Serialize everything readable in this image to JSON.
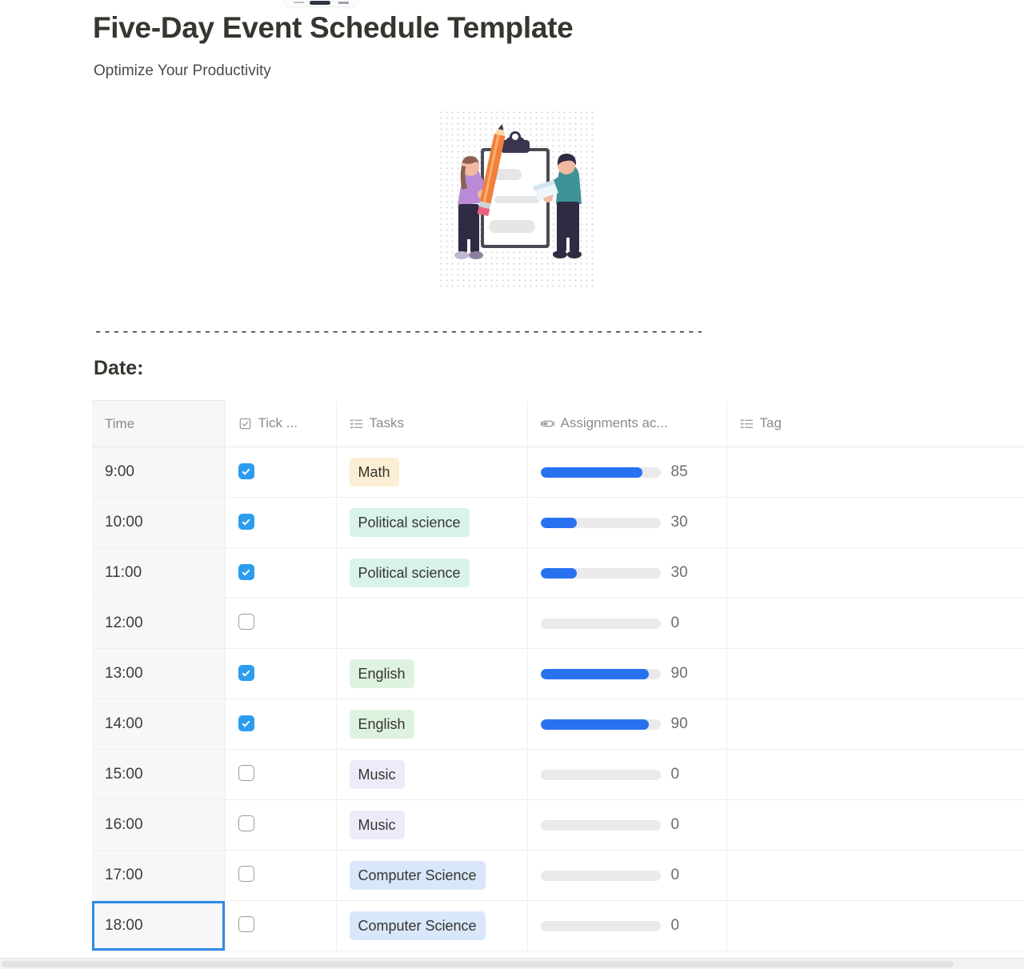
{
  "document": {
    "title": "Five-Day Event Schedule Template",
    "subtitle": "Optimize Your Productivity",
    "divider": "----------------------------------------------------------------------------",
    "date_label": "Date:"
  },
  "illustration": {
    "name": "clipboard-checklist-illustration",
    "alt": "Two people with a giant clipboard and pencil"
  },
  "table": {
    "columns": [
      {
        "key": "time",
        "label": "Time",
        "icon": ""
      },
      {
        "key": "tick",
        "label": "Tick ...",
        "icon": "checkbox-icon"
      },
      {
        "key": "tasks",
        "label": "Tasks",
        "icon": "select-list-icon"
      },
      {
        "key": "assignments",
        "label": "Assignments ac...",
        "icon": "progress-icon"
      },
      {
        "key": "tag",
        "label": "Tag",
        "icon": "select-list-icon"
      }
    ],
    "selected_cell": {
      "row": 9,
      "column": "time"
    },
    "rows": [
      {
        "time": "9:00",
        "tick": true,
        "task": "Math",
        "task_color": "#fbeed4",
        "progress": 85,
        "progress_label": "85",
        "tag": ""
      },
      {
        "time": "10:00",
        "tick": true,
        "task": "Political science",
        "task_color": "#d9f2ec",
        "progress": 30,
        "progress_label": "30",
        "tag": ""
      },
      {
        "time": "11:00",
        "tick": true,
        "task": "Political science",
        "task_color": "#d9f2ec",
        "progress": 30,
        "progress_label": "30",
        "tag": ""
      },
      {
        "time": "12:00",
        "tick": false,
        "task": "",
        "task_color": "",
        "progress": 0,
        "progress_label": "0",
        "tag": ""
      },
      {
        "time": "13:00",
        "tick": true,
        "task": "English",
        "task_color": "#ddf3df",
        "progress": 90,
        "progress_label": "90",
        "tag": ""
      },
      {
        "time": "14:00",
        "tick": true,
        "task": "English",
        "task_color": "#ddf3df",
        "progress": 90,
        "progress_label": "90",
        "tag": ""
      },
      {
        "time": "15:00",
        "tick": false,
        "task": "Music",
        "task_color": "#ecebfa",
        "progress": 0,
        "progress_label": "0",
        "tag": ""
      },
      {
        "time": "16:00",
        "tick": false,
        "task": "Music",
        "task_color": "#ecebfa",
        "progress": 0,
        "progress_label": "0",
        "tag": ""
      },
      {
        "time": "17:00",
        "tick": false,
        "task": "Computer Science",
        "task_color": "#d9e7fb",
        "progress": 0,
        "progress_label": "0",
        "tag": ""
      },
      {
        "time": "18:00",
        "tick": false,
        "task": "Computer Science",
        "task_color": "#d9e7fb",
        "progress": 0,
        "progress_label": "0",
        "tag": ""
      }
    ]
  },
  "colors": {
    "accent_blue": "#2872f0",
    "checkbox_blue": "#2b9cf0",
    "selection_blue": "#2e8ae6",
    "track_gray": "#eaeaea",
    "time_column_bg": "#f7f7f7",
    "text_primary": "#37352f",
    "text_muted": "#8b8b8b"
  }
}
